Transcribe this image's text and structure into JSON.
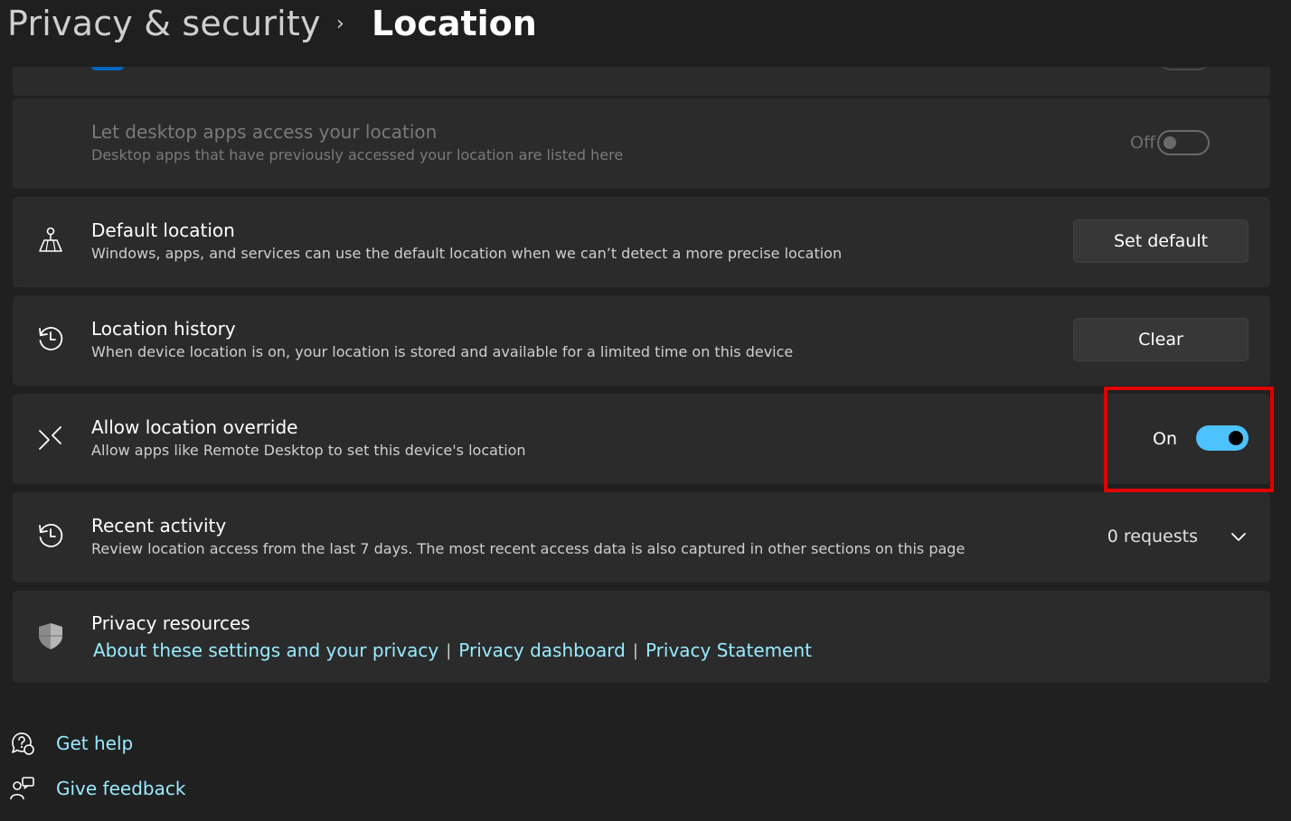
{
  "breadcrumb": {
    "parent": "Privacy & security",
    "separator": "›",
    "current": "Location"
  },
  "settings": {
    "desktop_apps": {
      "title": "Let desktop apps access your location",
      "description": "Desktop apps that have previously accessed your location are listed here",
      "state_label": "Off",
      "enabled": false
    },
    "default_location": {
      "title": "Default location",
      "description": "Windows, apps, and services can use the default location when we can’t detect a more precise location",
      "button": "Set default"
    },
    "location_history": {
      "title": "Location history",
      "description": "When device location is on, your location is stored and available for a limited time on this device",
      "button": "Clear"
    },
    "location_override": {
      "title": "Allow location override",
      "description": "Allow apps like Remote Desktop to set this device's location",
      "state_label": "On",
      "enabled": true
    },
    "recent_activity": {
      "title": "Recent activity",
      "description": "Review location access from the last 7 days. The most recent access data is also captured in other sections on this page",
      "value": "0 requests"
    },
    "privacy_resources": {
      "title": "Privacy resources",
      "links": [
        "About these settings and your privacy",
        "Privacy dashboard",
        "Privacy Statement"
      ],
      "divider": "|"
    }
  },
  "footer": {
    "help": "Get help",
    "feedback": "Give feedback"
  },
  "colors": {
    "accent": "#4cc2ff",
    "link": "#99ebff",
    "highlight": "#e00000",
    "card": "#2b2b2b",
    "background": "#202020"
  }
}
